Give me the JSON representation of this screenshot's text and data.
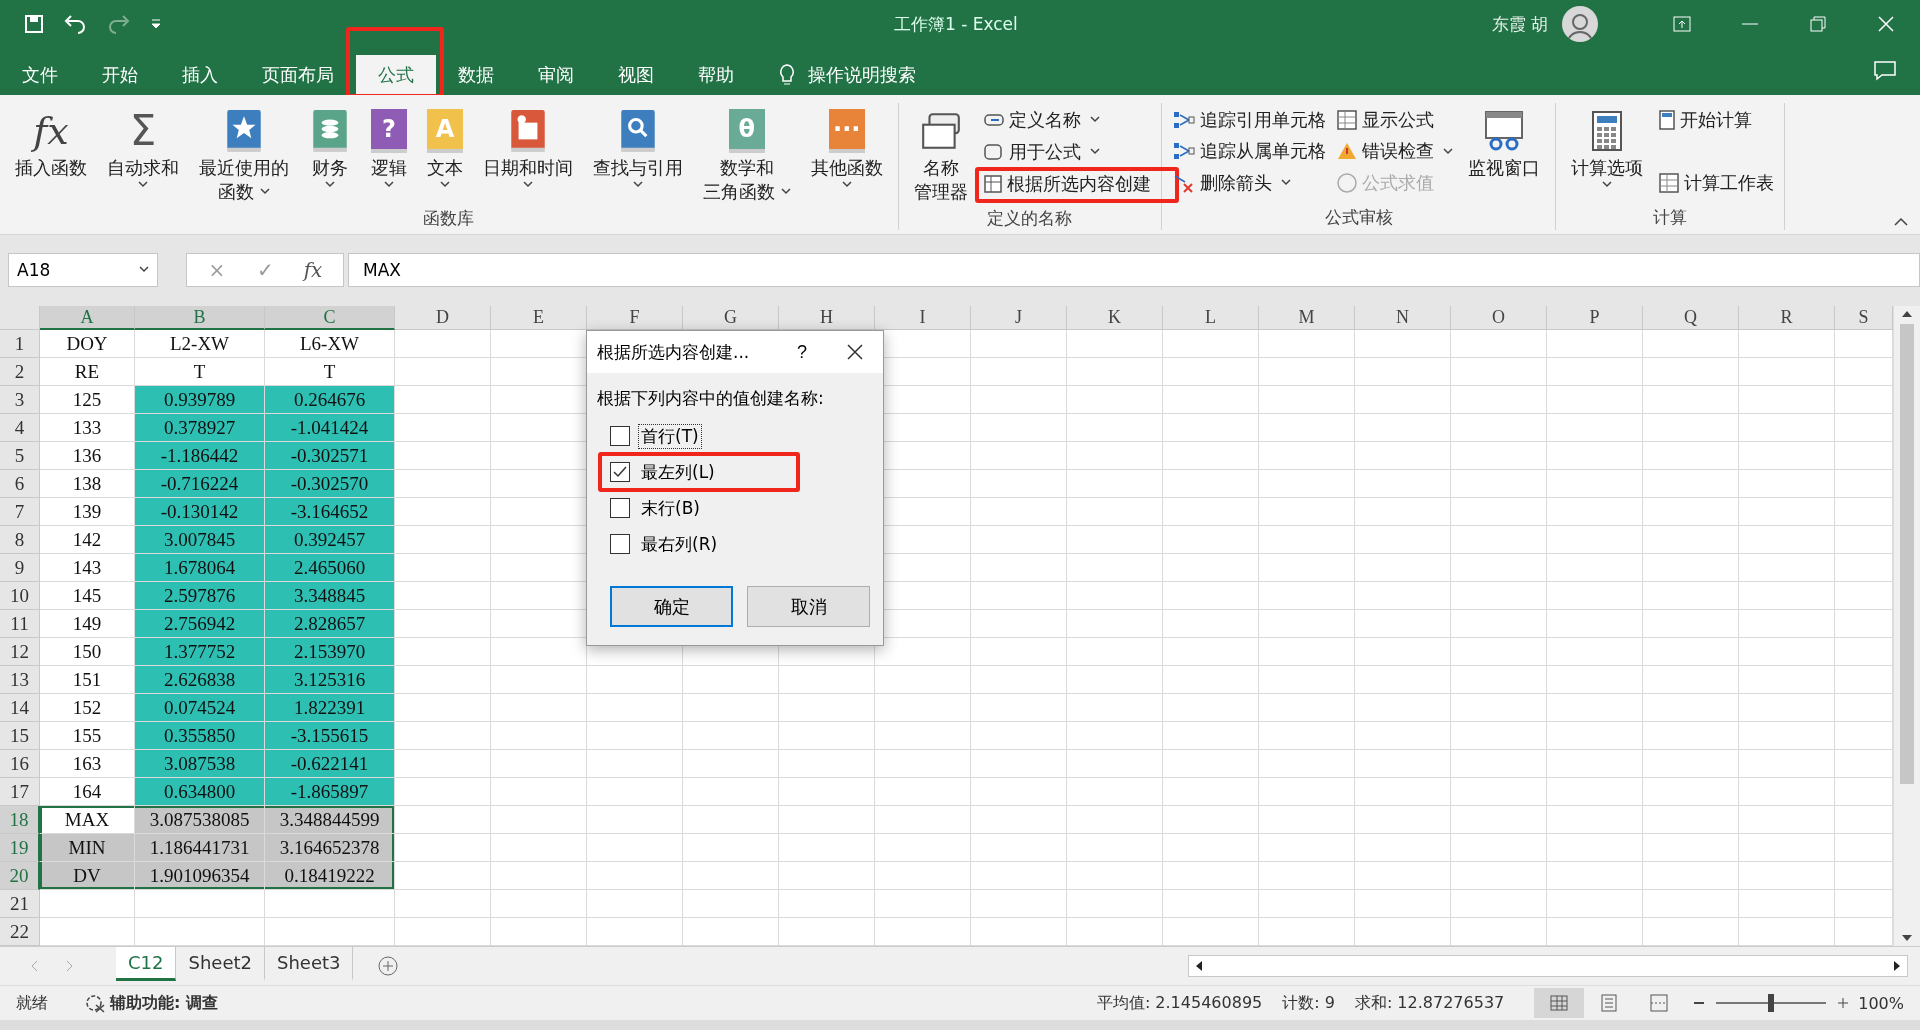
{
  "title_bar": {
    "title": "工作簿1  -  Excel",
    "user": "东霞 胡"
  },
  "tabs": [
    {
      "label": "文件",
      "selected": false,
      "highlighted": false
    },
    {
      "label": "开始",
      "selected": false,
      "highlighted": false
    },
    {
      "label": "插入",
      "selected": false,
      "highlighted": false
    },
    {
      "label": "页面布局",
      "selected": false,
      "highlighted": false
    },
    {
      "label": "公式",
      "selected": true,
      "highlighted": true
    },
    {
      "label": "数据",
      "selected": false,
      "highlighted": false
    },
    {
      "label": "审阅",
      "selected": false,
      "highlighted": false
    },
    {
      "label": "视图",
      "selected": false,
      "highlighted": false
    },
    {
      "label": "帮助",
      "selected": false,
      "highlighted": false
    }
  ],
  "tell_me": "操作说明搜索",
  "ribbon": {
    "groups": [
      {
        "label": "函数库",
        "columns": [
          {
            "kind": "glyph",
            "glyph": "fx",
            "lines": [
              "插入函数"
            ],
            "dropdown": false
          },
          {
            "kind": "sigma",
            "glyph": "Σ",
            "lines": [
              "自动求和"
            ],
            "dropdown": true
          },
          {
            "kind": "star-book",
            "color": "#3d7ebf",
            "lines": [
              "最近使用的",
              "函数"
            ],
            "dropdown": true
          },
          {
            "kind": "coin-book",
            "color": "#5aa58a",
            "lines": [
              "财务"
            ],
            "dropdown": true
          },
          {
            "kind": "glyph-book",
            "color": "#8e5bb5",
            "glyph": "?",
            "lines": [
              "逻辑"
            ],
            "dropdown": true
          },
          {
            "kind": "glyph-book",
            "color": "#f0c14b",
            "glyph": "A",
            "lines": [
              "文本"
            ],
            "dropdown": true
          },
          {
            "kind": "calendar-book",
            "color": "#d9573a",
            "lines": [
              "日期和时间"
            ],
            "dropdown": true
          },
          {
            "kind": "search-book",
            "color": "#3d7ebf",
            "lines": [
              "查找与引用"
            ],
            "dropdown": true
          },
          {
            "kind": "glyph-book",
            "color": "#6aab98",
            "glyph": "θ",
            "lines": [
              "数学和",
              "三角函数"
            ],
            "dropdown": true
          },
          {
            "kind": "glyph-book",
            "color": "#e8833a",
            "glyph": "···",
            "lines": [
              "其他函数"
            ],
            "dropdown": true
          }
        ]
      },
      {
        "label": "定义的名称",
        "columns": [
          {
            "kind": "tags",
            "lines": [
              "名称",
              "管理器"
            ],
            "dropdown": false
          },
          {
            "buttons": [
              {
                "kind": "tag",
                "label": "定义名称",
                "dropdown": true,
                "disabled": false,
                "highlighted": false
              },
              {
                "kind": "fx-tag",
                "label": "用于公式",
                "dropdown": true,
                "disabled": false,
                "highlighted": false
              },
              {
                "kind": "grid",
                "label": "根据所选内容创建",
                "dropdown": false,
                "disabled": false,
                "highlighted": true
              }
            ]
          }
        ]
      },
      {
        "label": "公式审核",
        "columns": [
          {
            "buttons": [
              {
                "kind": "trace",
                "label": "追踪引用单元格",
                "dropdown": false,
                "disabled": false,
                "highlighted": false
              },
              {
                "kind": "trace",
                "label": "追踪从属单元格",
                "dropdown": false,
                "disabled": false,
                "highlighted": false
              },
              {
                "kind": "remove",
                "label": "删除箭头",
                "dropdown": true,
                "disabled": false,
                "highlighted": false
              }
            ]
          },
          {
            "buttons": [
              {
                "kind": "sheet",
                "label": "显示公式",
                "dropdown": false,
                "disabled": false,
                "highlighted": false
              },
              {
                "kind": "warning",
                "label": "错误检查",
                "dropdown": true,
                "disabled": false,
                "highlighted": false
              },
              {
                "kind": "evaluate",
                "label": "公式求值",
                "dropdown": false,
                "disabled": true,
                "highlighted": false
              }
            ]
          },
          {
            "kind": "watch",
            "lines": [
              "监视窗口"
            ],
            "dropdown": false
          }
        ]
      },
      {
        "label": "计算",
        "columns": [
          {
            "kind": "calculator",
            "lines": [
              "计算选项"
            ],
            "dropdown": true
          },
          {
            "buttons": [
              {
                "kind": "calculator",
                "label": "开始计算",
                "dropdown": false,
                "disabled": false,
                "highlighted": false
              },
              {
                "kind": "sheet",
                "label": "计算工作表",
                "dropdown": false,
                "disabled": false,
                "highlighted": false
              }
            ]
          }
        ]
      }
    ]
  },
  "formula_bar": {
    "name_box": "A18",
    "cancel": "×",
    "enter": "✓",
    "function": "fx",
    "formula": "MAX"
  },
  "columns": [
    {
      "label": "A",
      "selected": true
    },
    {
      "label": "B",
      "selected": true
    },
    {
      "label": "C",
      "selected": true
    },
    {
      "label": "D",
      "selected": false
    },
    {
      "label": "E",
      "selected": false
    },
    {
      "label": "F",
      "selected": false
    },
    {
      "label": "G",
      "selected": false
    },
    {
      "label": "H",
      "selected": false
    },
    {
      "label": "I",
      "selected": false
    },
    {
      "label": "J",
      "selected": false
    },
    {
      "label": "K",
      "selected": false
    },
    {
      "label": "L",
      "selected": false
    },
    {
      "label": "M",
      "selected": false
    },
    {
      "label": "N",
      "selected": false
    },
    {
      "label": "O",
      "selected": false
    },
    {
      "label": "P",
      "selected": false
    },
    {
      "label": "Q",
      "selected": false
    },
    {
      "label": "R",
      "selected": false
    },
    {
      "label": "S",
      "selected": false
    }
  ],
  "rows": [
    {
      "header": "1",
      "selected": false,
      "cells": [
        {
          "text": "DOY"
        },
        {
          "text": "L2-XW"
        },
        {
          "text": "L6-XW"
        }
      ]
    },
    {
      "header": "2",
      "selected": false,
      "cells": [
        {
          "text": "RE"
        },
        {
          "text": "T"
        },
        {
          "text": "T"
        }
      ]
    },
    {
      "header": "3",
      "selected": false,
      "cells": [
        {
          "text": "125"
        },
        {
          "text": "0.939789",
          "color": "#2ebfb3"
        },
        {
          "text": "0.264676",
          "color": "#2ebfb3"
        }
      ]
    },
    {
      "header": "4",
      "selected": false,
      "cells": [
        {
          "text": "133"
        },
        {
          "text": "0.378927",
          "color": "#2ebfb3"
        },
        {
          "text": "-1.041424",
          "color": "#2ebfb3"
        }
      ]
    },
    {
      "header": "5",
      "selected": false,
      "cells": [
        {
          "text": "136"
        },
        {
          "text": "-1.186442",
          "color": "#2ebfb3"
        },
        {
          "text": "-0.302571",
          "color": "#2ebfb3"
        }
      ]
    },
    {
      "header": "6",
      "selected": false,
      "cells": [
        {
          "text": "138"
        },
        {
          "text": "-0.716224",
          "color": "#2ebfb3"
        },
        {
          "text": "-0.302570",
          "color": "#2ebfb3"
        }
      ]
    },
    {
      "header": "7",
      "selected": false,
      "cells": [
        {
          "text": "139"
        },
        {
          "text": "-0.130142",
          "color": "#2ebfb3"
        },
        {
          "text": "-3.164652",
          "color": "#2ebfb3"
        }
      ]
    },
    {
      "header": "8",
      "selected": false,
      "cells": [
        {
          "text": "142"
        },
        {
          "text": "3.007845",
          "color": "#2ebfb3"
        },
        {
          "text": "0.392457",
          "color": "#2ebfb3"
        }
      ]
    },
    {
      "header": "9",
      "selected": false,
      "cells": [
        {
          "text": "143"
        },
        {
          "text": "1.678064",
          "color": "#2ebfb3"
        },
        {
          "text": "2.465060",
          "color": "#2ebfb3"
        }
      ]
    },
    {
      "header": "10",
      "selected": false,
      "cells": [
        {
          "text": "145"
        },
        {
          "text": "2.597876",
          "color": "#2ebfb3"
        },
        {
          "text": "3.348845",
          "color": "#2ebfb3"
        }
      ]
    },
    {
      "header": "11",
      "selected": false,
      "cells": [
        {
          "text": "149"
        },
        {
          "text": "2.756942",
          "color": "#2ebfb3"
        },
        {
          "text": "2.828657",
          "color": "#2ebfb3"
        }
      ]
    },
    {
      "header": "12",
      "selected": false,
      "cells": [
        {
          "text": "150"
        },
        {
          "text": "1.377752",
          "color": "#2ebfb3"
        },
        {
          "text": "2.153970",
          "color": "#2ebfb3"
        }
      ]
    },
    {
      "header": "13",
      "selected": false,
      "cells": [
        {
          "text": "151"
        },
        {
          "text": "2.626838",
          "color": "#2ebfb3"
        },
        {
          "text": "3.125316",
          "color": "#2ebfb3"
        }
      ]
    },
    {
      "header": "14",
      "selected": false,
      "cells": [
        {
          "text": "152"
        },
        {
          "text": "0.074524",
          "color": "#2ebfb3"
        },
        {
          "text": "1.822391",
          "color": "#2ebfb3"
        }
      ]
    },
    {
      "header": "15",
      "selected": false,
      "cells": [
        {
          "text": "155"
        },
        {
          "text": "0.355850",
          "color": "#2ebfb3"
        },
        {
          "text": "-3.155615",
          "color": "#2ebfb3"
        }
      ]
    },
    {
      "header": "16",
      "selected": false,
      "cells": [
        {
          "text": "163"
        },
        {
          "text": "3.087538",
          "color": "#2ebfb3"
        },
        {
          "text": "-0.622141",
          "color": "#2ebfb3"
        }
      ]
    },
    {
      "header": "17",
      "selected": false,
      "cells": [
        {
          "text": "164"
        },
        {
          "text": "0.634800",
          "color": "#2ebfb3"
        },
        {
          "text": "-1.865897",
          "color": "#2ebfb3"
        }
      ]
    },
    {
      "header": "18",
      "selected": true,
      "cells": [
        {
          "text": "MAX"
        },
        {
          "text": "3.087538085"
        },
        {
          "text": "3.348844599"
        }
      ]
    },
    {
      "header": "19",
      "selected": true,
      "cells": [
        {
          "text": "MIN"
        },
        {
          "text": "1.186441731"
        },
        {
          "text": "3.164652378"
        }
      ]
    },
    {
      "header": "20",
      "selected": true,
      "cells": [
        {
          "text": "DV"
        },
        {
          "text": "1.901096354"
        },
        {
          "text": "0.18419222"
        }
      ]
    },
    {
      "header": "21",
      "selected": false
    },
    {
      "header": "22",
      "selected": false
    }
  ],
  "sheets": [
    {
      "label": "C12",
      "selected": true
    },
    {
      "label": "Sheet2",
      "selected": false
    },
    {
      "label": "Sheet3",
      "selected": false
    }
  ],
  "status_bar": {
    "state": "就绪",
    "accessibility": "辅助功能: 调查",
    "average": "平均值: 2.145460895",
    "count": "计数: 9",
    "sum": "求和: 12.87276537",
    "views": [
      {
        "kind": "normal",
        "selected": true
      },
      {
        "kind": "layout",
        "selected": false
      },
      {
        "kind": "break",
        "selected": false
      }
    ],
    "zoom": {
      "level": 0.5,
      "text": "100%"
    }
  },
  "dialog": {
    "title": "根据所选内容创建...",
    "help": "?",
    "prompt": "根据下列内容中的值创建名称:",
    "options": [
      {
        "label": "首行(T)",
        "checked": false,
        "focused": true,
        "highlighted": false
      },
      {
        "label": "最左列(L)",
        "checked": true,
        "focused": false,
        "highlighted": true
      },
      {
        "label": "末行(B)",
        "checked": false,
        "focused": false,
        "highlighted": false
      },
      {
        "label": "最右列(R)",
        "checked": false,
        "focused": false,
        "highlighted": false
      }
    ],
    "buttons": [
      {
        "label": "确定",
        "selected": true
      },
      {
        "label": "取消",
        "selected": false
      }
    ]
  }
}
